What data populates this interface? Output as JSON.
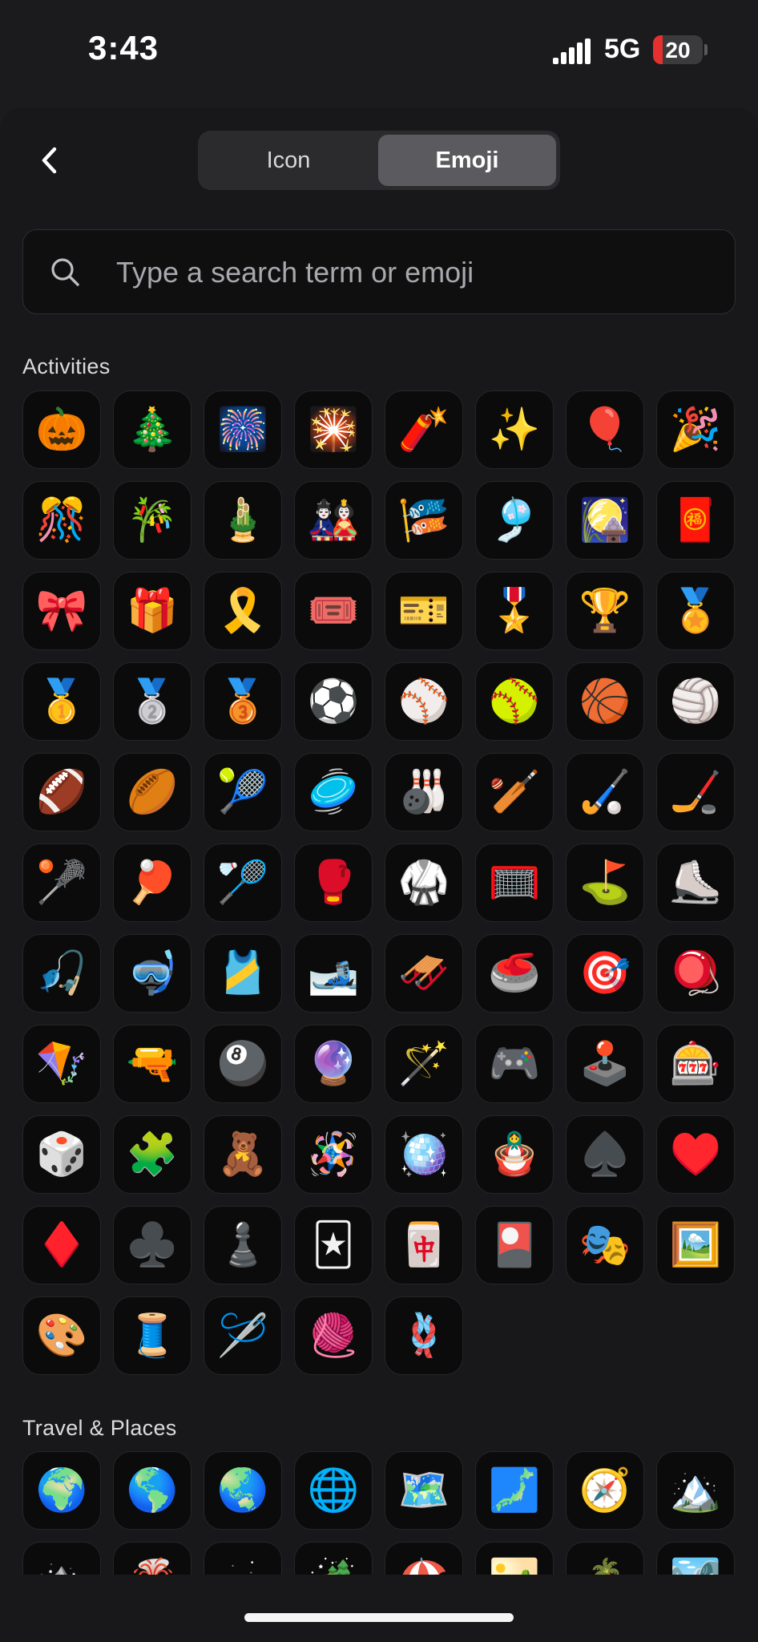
{
  "status_bar": {
    "time": "3:43",
    "network": "5G",
    "battery": "20",
    "battery_level": 0.2
  },
  "segmented": {
    "icon_label": "Icon",
    "emoji_label": "Emoji",
    "selected": "Emoji"
  },
  "search": {
    "placeholder": "Type a search term or emoji",
    "value": ""
  },
  "sections": [
    {
      "title": "Activities",
      "items": [
        {
          "emoji": "🎃",
          "name": "jack-o-lantern"
        },
        {
          "emoji": "🎄",
          "name": "christmas-tree"
        },
        {
          "emoji": "🎆",
          "name": "fireworks"
        },
        {
          "emoji": "🎇",
          "name": "sparkler"
        },
        {
          "emoji": "🧨",
          "name": "firecracker"
        },
        {
          "emoji": "✨",
          "name": "sparkles"
        },
        {
          "emoji": "🎈",
          "name": "balloon"
        },
        {
          "emoji": "🎉",
          "name": "party-popper"
        },
        {
          "emoji": "🎊",
          "name": "confetti-ball"
        },
        {
          "emoji": "🎋",
          "name": "tanabata-tree"
        },
        {
          "emoji": "🎍",
          "name": "pine-decoration"
        },
        {
          "emoji": "🎎",
          "name": "japanese-dolls"
        },
        {
          "emoji": "🎏",
          "name": "carp-streamer"
        },
        {
          "emoji": "🎐",
          "name": "wind-chime"
        },
        {
          "emoji": "🎑",
          "name": "moon-viewing-ceremony"
        },
        {
          "emoji": "🧧",
          "name": "red-envelope"
        },
        {
          "emoji": "🎀",
          "name": "ribbon"
        },
        {
          "emoji": "🎁",
          "name": "wrapped-gift"
        },
        {
          "emoji": "🎗️",
          "name": "reminder-ribbon"
        },
        {
          "emoji": "🎟️",
          "name": "admission-tickets"
        },
        {
          "emoji": "🎫",
          "name": "ticket"
        },
        {
          "emoji": "🎖️",
          "name": "military-medal"
        },
        {
          "emoji": "🏆",
          "name": "trophy"
        },
        {
          "emoji": "🏅",
          "name": "sports-medal"
        },
        {
          "emoji": "🥇",
          "name": "first-place-medal"
        },
        {
          "emoji": "🥈",
          "name": "second-place-medal"
        },
        {
          "emoji": "🥉",
          "name": "third-place-medal"
        },
        {
          "emoji": "⚽",
          "name": "soccer-ball"
        },
        {
          "emoji": "⚾",
          "name": "baseball"
        },
        {
          "emoji": "🥎",
          "name": "softball"
        },
        {
          "emoji": "🏀",
          "name": "basketball"
        },
        {
          "emoji": "🏐",
          "name": "volleyball"
        },
        {
          "emoji": "🏈",
          "name": "american-football"
        },
        {
          "emoji": "🏉",
          "name": "rugby-football"
        },
        {
          "emoji": "🎾",
          "name": "tennis"
        },
        {
          "emoji": "🥏",
          "name": "flying-disc"
        },
        {
          "emoji": "🎳",
          "name": "bowling"
        },
        {
          "emoji": "🏏",
          "name": "cricket-game"
        },
        {
          "emoji": "🏑",
          "name": "field-hockey"
        },
        {
          "emoji": "🏒",
          "name": "ice-hockey"
        },
        {
          "emoji": "🥍",
          "name": "lacrosse"
        },
        {
          "emoji": "🏓",
          "name": "ping-pong"
        },
        {
          "emoji": "🏸",
          "name": "badminton"
        },
        {
          "emoji": "🥊",
          "name": "boxing-glove"
        },
        {
          "emoji": "🥋",
          "name": "martial-arts-uniform"
        },
        {
          "emoji": "🥅",
          "name": "goal-net"
        },
        {
          "emoji": "⛳",
          "name": "flag-in-hole"
        },
        {
          "emoji": "⛸️",
          "name": "ice-skate"
        },
        {
          "emoji": "🎣",
          "name": "fishing-pole"
        },
        {
          "emoji": "🤿",
          "name": "diving-mask"
        },
        {
          "emoji": "🎽",
          "name": "running-shirt"
        },
        {
          "emoji": "🎿",
          "name": "skis"
        },
        {
          "emoji": "🛷",
          "name": "sled"
        },
        {
          "emoji": "🥌",
          "name": "curling-stone"
        },
        {
          "emoji": "🎯",
          "name": "bullseye"
        },
        {
          "emoji": "🪀",
          "name": "yo-yo"
        },
        {
          "emoji": "🪁",
          "name": "kite"
        },
        {
          "emoji": "🔫",
          "name": "water-pistol"
        },
        {
          "emoji": "🎱",
          "name": "pool-8-ball"
        },
        {
          "emoji": "🔮",
          "name": "crystal-ball"
        },
        {
          "emoji": "🪄",
          "name": "magic-wand"
        },
        {
          "emoji": "🎮",
          "name": "video-game"
        },
        {
          "emoji": "🕹️",
          "name": "joystick"
        },
        {
          "emoji": "🎰",
          "name": "slot-machine"
        },
        {
          "emoji": "🎲",
          "name": "game-die"
        },
        {
          "emoji": "🧩",
          "name": "puzzle-piece"
        },
        {
          "emoji": "🧸",
          "name": "teddy-bear"
        },
        {
          "emoji": "🪅",
          "name": "pinata"
        },
        {
          "emoji": "🪩",
          "name": "mirror-ball"
        },
        {
          "emoji": "🪆",
          "name": "nesting-dolls"
        },
        {
          "emoji": "♠️",
          "name": "spade-suit"
        },
        {
          "emoji": "♥️",
          "name": "heart-suit"
        },
        {
          "emoji": "♦️",
          "name": "diamond-suit"
        },
        {
          "emoji": "♣️",
          "name": "club-suit"
        },
        {
          "emoji": "♟️",
          "name": "chess-pawn"
        },
        {
          "emoji": "🃏",
          "name": "joker"
        },
        {
          "emoji": "🀄",
          "name": "mahjong-red-dragon"
        },
        {
          "emoji": "🎴",
          "name": "flower-playing-cards"
        },
        {
          "emoji": "🎭",
          "name": "performing-arts"
        },
        {
          "emoji": "🖼️",
          "name": "framed-picture"
        },
        {
          "emoji": "🎨",
          "name": "artist-palette"
        },
        {
          "emoji": "🧵",
          "name": "thread"
        },
        {
          "emoji": "🪡",
          "name": "sewing-needle"
        },
        {
          "emoji": "🧶",
          "name": "yarn"
        },
        {
          "emoji": "🪢",
          "name": "knot"
        }
      ]
    },
    {
      "title": "Travel & Places",
      "items": [
        {
          "emoji": "🌍",
          "name": "globe-europe-africa"
        },
        {
          "emoji": "🌎",
          "name": "globe-americas"
        },
        {
          "emoji": "🌏",
          "name": "globe-asia-australia"
        },
        {
          "emoji": "🌐",
          "name": "globe-with-meridians"
        },
        {
          "emoji": "🗺️",
          "name": "world-map"
        },
        {
          "emoji": "🗾",
          "name": "map-of-japan"
        },
        {
          "emoji": "🧭",
          "name": "compass"
        },
        {
          "emoji": "🏔️",
          "name": "snow-capped-mountain"
        },
        {
          "emoji": "⛰️",
          "name": "mountain"
        },
        {
          "emoji": "🌋",
          "name": "volcano"
        },
        {
          "emoji": "🗻",
          "name": "mount-fuji"
        },
        {
          "emoji": "🏕️",
          "name": "camping"
        },
        {
          "emoji": "🏖️",
          "name": "beach-with-umbrella"
        },
        {
          "emoji": "🏜️",
          "name": "desert"
        },
        {
          "emoji": "🏝️",
          "name": "desert-island"
        },
        {
          "emoji": "🏞️",
          "name": "national-park"
        }
      ]
    }
  ]
}
